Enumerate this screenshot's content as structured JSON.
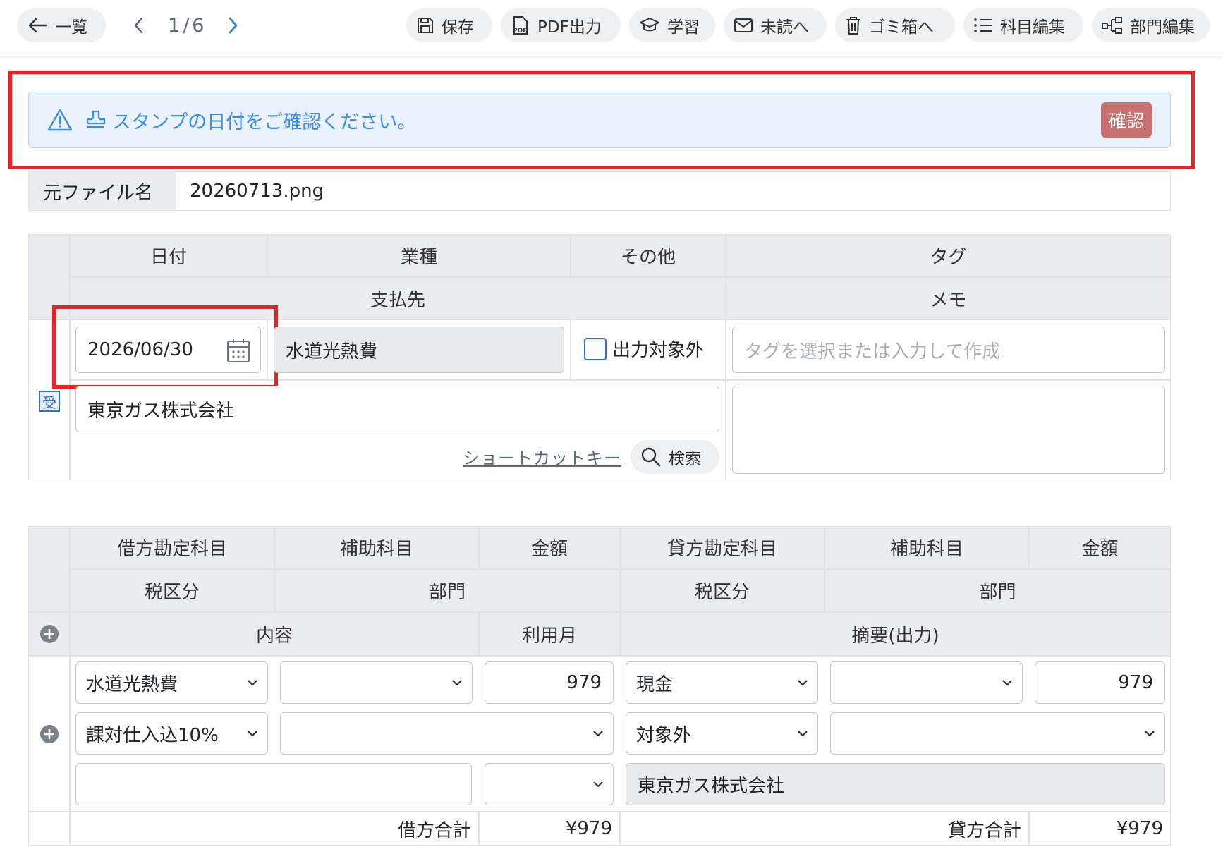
{
  "toolbar": {
    "back_label": "一覧",
    "pager": {
      "current": "1",
      "sep": "/",
      "total": "6"
    },
    "buttons": [
      {
        "label": "保存",
        "icon": "save-icon"
      },
      {
        "label": "PDF出力",
        "icon": "pdf-icon"
      },
      {
        "label": "学習",
        "icon": "graduation-cap-icon"
      },
      {
        "label": "未読へ",
        "icon": "envelope-icon"
      },
      {
        "label": "ゴミ箱へ",
        "icon": "trash-icon"
      },
      {
        "label": "科目編集",
        "icon": "list-icon"
      },
      {
        "label": "部門編集",
        "icon": "diagram-icon"
      }
    ]
  },
  "alert": {
    "message": "スタンプの日付をご確認ください。",
    "confirm_label": "確認"
  },
  "file": {
    "label": "元ファイル名",
    "value": "20260713.png"
  },
  "header_table": {
    "headers": {
      "date": "日付",
      "industry": "業種",
      "other": "その他",
      "tag": "タグ",
      "payee": "支払先",
      "memo": "メモ"
    },
    "date_value": "2026/06/30",
    "industry_value": "水道光熱費",
    "exclude_label": "出力対象外",
    "tag_placeholder": "タグを選択または入力して作成",
    "payee_value": "東京ガス株式会社",
    "received_badge": "受",
    "shortcut_link": "ショートカットキー",
    "search_label": "検索",
    "memo_value": ""
  },
  "journal": {
    "headers": {
      "debit_account": "借方勘定科目",
      "debit_sub": "補助科目",
      "debit_amount": "金額",
      "credit_account": "貸方勘定科目",
      "credit_sub": "補助科目",
      "credit_amount": "金額",
      "debit_tax": "税区分",
      "debit_dept": "部門",
      "credit_tax": "税区分",
      "credit_dept": "部門",
      "content": "内容",
      "usage_month": "利用月",
      "summary": "摘要(出力)"
    },
    "row": {
      "debit_account": "水道光熱費",
      "debit_sub": "",
      "debit_amount": "979",
      "credit_account": "現金",
      "credit_sub": "",
      "credit_amount": "979",
      "debit_tax": "課対仕入込10%",
      "debit_dept": "",
      "credit_tax": "対象外",
      "credit_dept": "",
      "content": "",
      "usage_month": "",
      "summary": "東京ガス株式会社"
    },
    "totals": {
      "debit_label": "借方合計",
      "debit_value": "¥979",
      "credit_label": "貸方合計",
      "credit_value": "¥979"
    }
  },
  "colors": {
    "alert_bg": "#eaf3fc",
    "alert_text": "#3d8ce6",
    "confirm_bg": "#c97171",
    "highlight": "#f02020",
    "pager_next": "#2a7fe0"
  }
}
